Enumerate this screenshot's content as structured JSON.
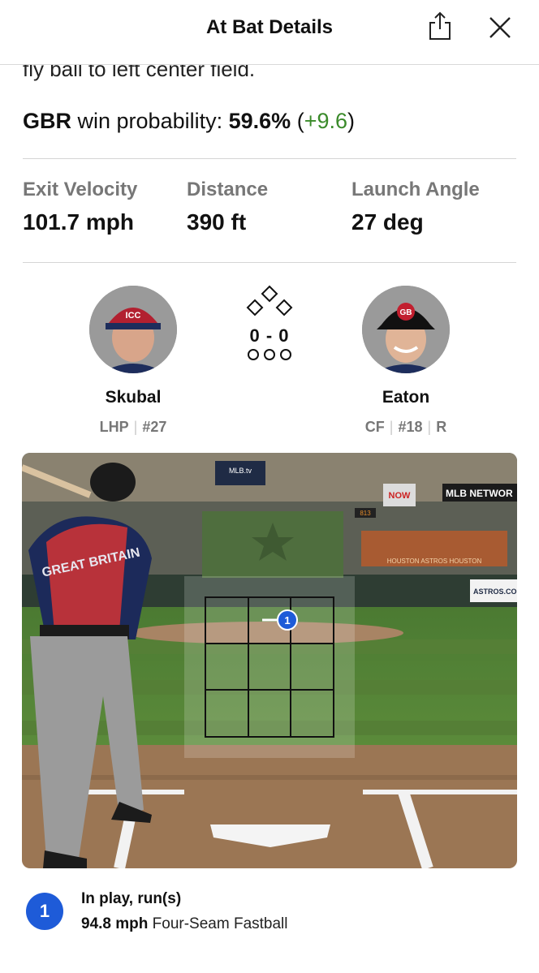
{
  "header": {
    "title": "At Bat Details"
  },
  "play": {
    "description": "fly ball to left center field.",
    "team": "GBR",
    "winprob_label": "win probability:",
    "winprob_value": "59.6%",
    "winprob_open": "(",
    "winprob_change": "+9.6",
    "winprob_close": ")"
  },
  "stats": [
    {
      "label": "Exit Velocity",
      "value": "101.7 mph"
    },
    {
      "label": "Distance",
      "value": "390 ft"
    },
    {
      "label": "Launch Angle",
      "value": "27 deg"
    }
  ],
  "pitcher": {
    "name": "Skubal",
    "position": "LHP",
    "number": "#27",
    "cap_logo": "ICC"
  },
  "batter": {
    "name": "Eaton",
    "position": "CF",
    "number": "#18",
    "bats": "R",
    "cap_logo": "GB"
  },
  "count": {
    "balls_strikes": "0 - 0",
    "outs": 3,
    "bases_occupied": [
      false,
      false,
      false
    ]
  },
  "field": {
    "scoreboard_text": [
      "NOW",
      "MLB NETWOR",
      "ASTROS.COM",
      "MLB.tv",
      "813",
      "HOUSTON ASTROS HOUSTON"
    ],
    "jersey_text": "GREAT BRITAIN",
    "zone_pitch_label": "1"
  },
  "pitch": {
    "number": "1",
    "result": "In play, run(s)",
    "speed": "94.8 mph",
    "type": "Four-Seam Fastball"
  },
  "colors": {
    "accent_blue": "#1e5bd8",
    "positive_green": "#3a8a2a",
    "label_gray": "#777777"
  },
  "icons": [
    "share-icon",
    "close-icon",
    "bases-diamond-icon",
    "outs-circles-icon"
  ]
}
